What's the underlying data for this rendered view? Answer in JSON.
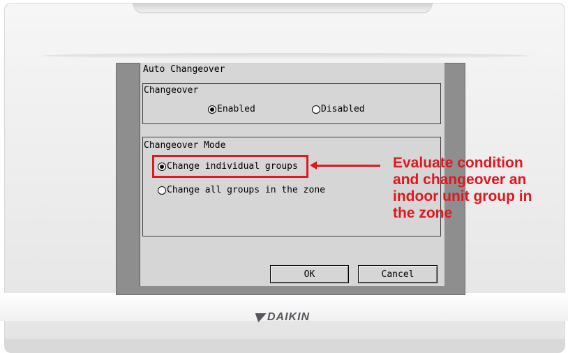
{
  "dialog": {
    "title": "Auto Changeover",
    "changeover": {
      "label": "Changeover",
      "options": [
        {
          "label": "Enabled",
          "selected": true
        },
        {
          "label": "Disabled",
          "selected": false
        }
      ]
    },
    "mode": {
      "label": "Changeover Mode",
      "options": [
        {
          "label": "Change individual groups",
          "selected": true
        },
        {
          "label": "Change all groups in the zone",
          "selected": false
        }
      ]
    },
    "buttons": {
      "ok": "OK",
      "cancel": "Cancel"
    }
  },
  "annotation": {
    "text_lines": [
      "Evaluate condition",
      "and changeover an",
      "indoor unit group in",
      "the zone"
    ],
    "color": "#e2161f"
  },
  "device": {
    "brand": "DAIKIN"
  }
}
